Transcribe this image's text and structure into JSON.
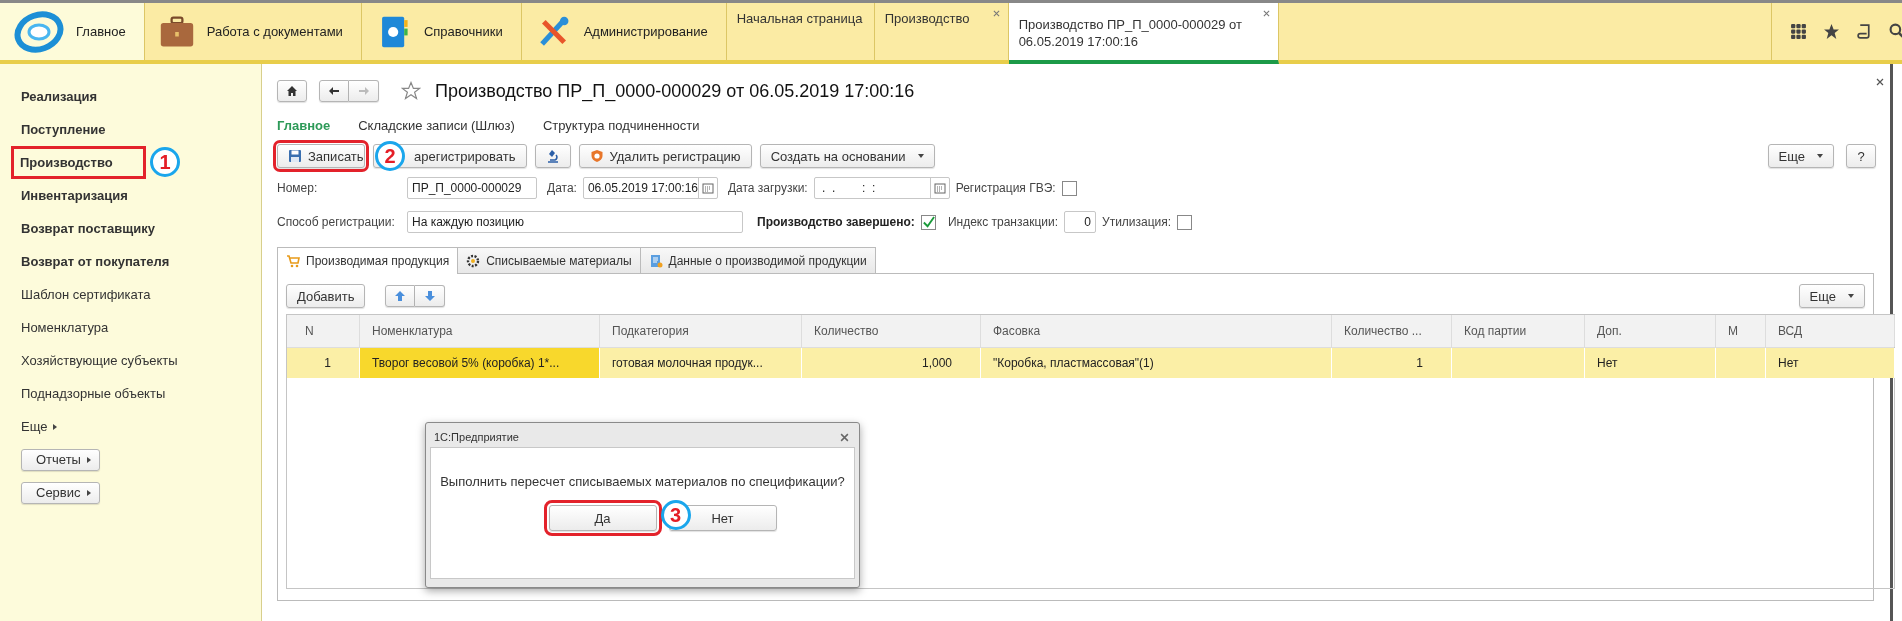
{
  "sections": [
    {
      "label": "Главное",
      "selected": true
    },
    {
      "label": "Работа с документами",
      "selected": false
    },
    {
      "label": "Справочники",
      "selected": false
    },
    {
      "label": "Администрирование",
      "selected": false
    }
  ],
  "open_tabs": [
    {
      "title": "Начальная страница",
      "selected": false,
      "closable": false
    },
    {
      "title": "Производство",
      "selected": false,
      "closable": true
    },
    {
      "title": "Производство ПР_П_0000-000029 от 06.05.2019 17:00:16",
      "selected": true,
      "closable": true
    }
  ],
  "sidebar": {
    "items": [
      {
        "label": "Реализация",
        "kind": "main",
        "highlighted": false
      },
      {
        "label": "Поступление",
        "kind": "main",
        "highlighted": false
      },
      {
        "label": "Производство",
        "kind": "main",
        "highlighted": true,
        "annotation": "1"
      },
      {
        "label": "Инвентаризация",
        "kind": "main",
        "highlighted": false
      },
      {
        "label": "Возврат поставщику",
        "kind": "main",
        "highlighted": false
      },
      {
        "label": "Возврат от покупателя",
        "kind": "main",
        "highlighted": false
      },
      {
        "label": "Шаблон сертификата",
        "kind": "link",
        "highlighted": false
      },
      {
        "label": "Номенклатура",
        "kind": "link",
        "highlighted": false
      },
      {
        "label": "Хозяйствующие субъекты",
        "kind": "link",
        "highlighted": false
      },
      {
        "label": "Поднадзорные объекты",
        "kind": "link",
        "highlighted": false
      },
      {
        "label": "Еще",
        "kind": "more",
        "highlighted": false
      },
      {
        "label": "Отчеты",
        "kind": "button",
        "highlighted": false
      },
      {
        "label": "Сервис",
        "kind": "button",
        "highlighted": false
      }
    ]
  },
  "form": {
    "title": "Производство ПР_П_0000-000029 от 06.05.2019 17:00:16",
    "nav_tabs": [
      {
        "label": "Главное",
        "selected": true
      },
      {
        "label": "Складские записи (Шлюз)",
        "selected": false
      },
      {
        "label": "Структура подчиненности",
        "selected": false
      }
    ],
    "commands": [
      {
        "label": "Записать",
        "highlighted": true,
        "annotation": "2"
      },
      {
        "label": "арегистрировать",
        "highlighted": false
      },
      {
        "highlighted": false
      },
      {
        "label": "Удалить регистрацию",
        "highlighted": false
      },
      {
        "label": "Создать на основании",
        "highlighted": false
      }
    ],
    "more_button": "Еще",
    "help_button": "?",
    "number": {
      "label": "Номер:",
      "value": "ПР_П_0000-000029"
    },
    "date": {
      "label": "Дата:",
      "value": "06.05.2019 17:00:16"
    },
    "load_date": {
      "label": "Дата загрузки:",
      "value": " .  .        :  :"
    },
    "gve": {
      "label": "Регистрация ГВЭ:",
      "checked": false
    },
    "method": {
      "label": "Способ регистрации:",
      "value": "На каждую позицию"
    },
    "completed": {
      "label": "Производство завершено:",
      "checked": true
    },
    "tx_index": {
      "label": "Индекс транзакции:",
      "value": "0"
    },
    "disposal": {
      "label": "Утилизация:",
      "checked": false
    },
    "tabs": [
      {
        "label": "Производимая продукция",
        "selected": true
      },
      {
        "label": "Списываемые материалы",
        "selected": false
      },
      {
        "label": "Данные о производимой продукции",
        "selected": false
      }
    ],
    "add_button": "Добавить",
    "table_more": "Еще",
    "table": {
      "columns": [
        {
          "title": "N",
          "kind": "number"
        },
        {
          "title": "Номенклатура",
          "kind": "text"
        },
        {
          "title": "Подкатегория",
          "kind": "text"
        },
        {
          "title": "Количество",
          "kind": "number"
        },
        {
          "title": "Фасовка",
          "kind": "text"
        },
        {
          "title": "Количество ...",
          "kind": "number"
        },
        {
          "title": "Код партии",
          "kind": "text"
        },
        {
          "title": "Доп.",
          "kind": "text"
        },
        {
          "title": "М",
          "kind": "text"
        },
        {
          "title": "ВСД",
          "kind": "text"
        }
      ],
      "rows": [
        {
          "selected": true,
          "cells": [
            {
              "text": "1",
              "selected": false
            },
            {
              "text": "Творог весовой 5%  (коробка) 1*...",
              "selected": true
            },
            {
              "text": "готовая молочная продук...",
              "selected": false
            },
            {
              "text": "1,000",
              "selected": false
            },
            {
              "text": "\"Коробка, пластмассовая\"(1)",
              "selected": false
            },
            {
              "text": "1",
              "selected": false
            },
            {
              "text": "",
              "selected": false
            },
            {
              "text": "Нет",
              "selected": false
            },
            {
              "text": "",
              "selected": false
            },
            {
              "text": "Нет",
              "selected": false
            }
          ]
        }
      ]
    }
  },
  "dialog": {
    "title": "1С:Предприятие",
    "message": "Выполнить пересчет списываемых материалов по спецификации?",
    "buttons": [
      {
        "label": "Да",
        "highlighted": true,
        "annotation": "3"
      },
      {
        "label": "Нет",
        "highlighted": false
      }
    ]
  }
}
